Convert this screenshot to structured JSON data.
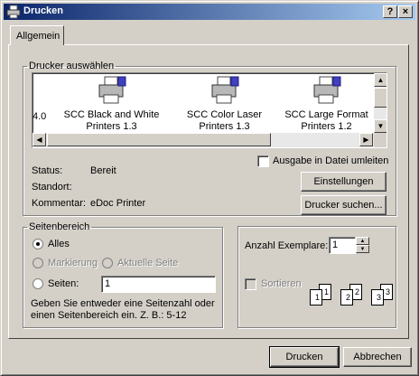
{
  "window": {
    "title": "Drucken",
    "help_button": "?",
    "close_button": "×"
  },
  "tabs": {
    "general": "Allgemein"
  },
  "printer_select": {
    "legend": "Drucker auswählen",
    "partial_item": "4.0",
    "printers": [
      {
        "line1": "SCC Black and White",
        "line2": "Printers 1.3"
      },
      {
        "line1": "SCC Color Laser",
        "line2": "Printers 1.3"
      },
      {
        "line1": "SCC Large Format",
        "line2": "Printers 1.2"
      }
    ],
    "status_label": "Status:",
    "status_value": "Bereit",
    "location_label": "Standort:",
    "location_value": "",
    "comment_label": "Kommentar:",
    "comment_value": "eDoc Printer",
    "print_to_file": "Ausgabe in Datei umleiten",
    "settings_button": "Einstellungen",
    "find_printer_button": "Drucker suchen..."
  },
  "page_range": {
    "legend": "Seitenbereich",
    "all": "Alles",
    "selection": "Markierung",
    "current_page": "Aktuelle Seite",
    "pages": "Seiten:",
    "pages_value": "1",
    "hint": "Geben Sie entweder eine Seitenzahl oder einen Seitenbereich ein. Z. B.: 5-12"
  },
  "copies": {
    "label": "Anzahl Exemplare:",
    "value": "1",
    "collate": "Sortieren",
    "pages": [
      "1",
      "1",
      "2",
      "2",
      "3",
      "3"
    ]
  },
  "footer": {
    "print_button": "Drucken",
    "cancel_button": "Abbrechen"
  }
}
